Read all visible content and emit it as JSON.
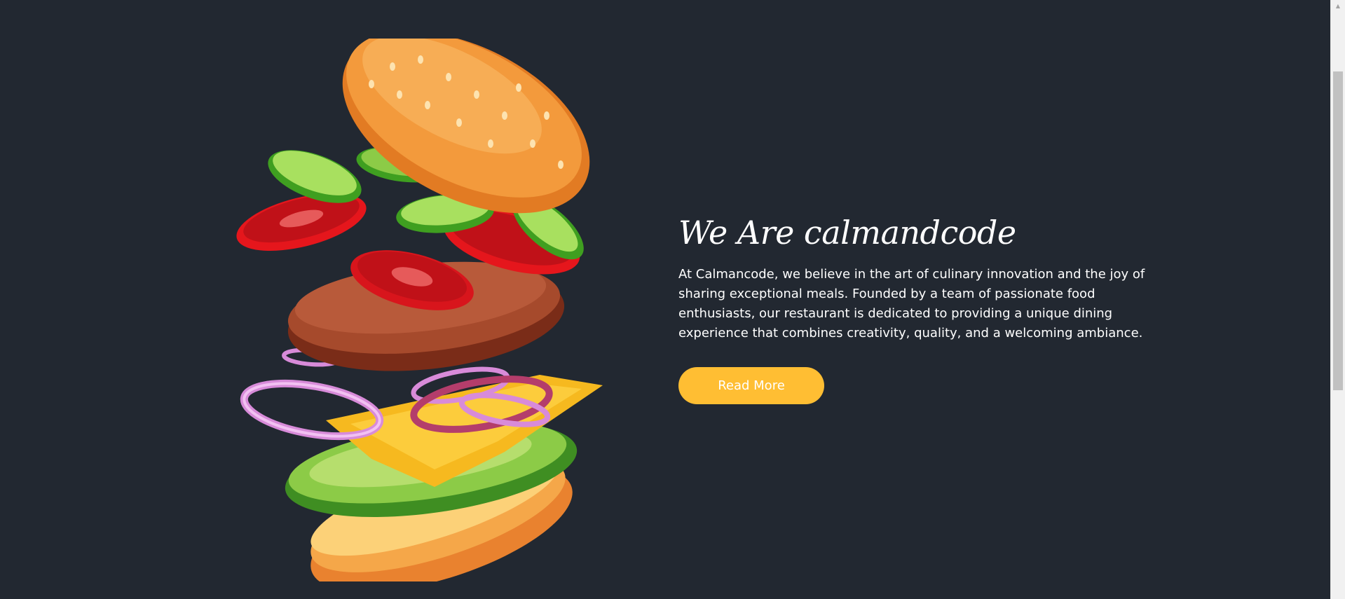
{
  "about": {
    "title": "We Are calmandcode",
    "text": "At Calmancode, we believe in the art of culinary innovation and the joy of sharing exceptional meals. Founded by a team of passionate food enthusiasts, our restaurant is dedicated to providing a unique dining experience that combines creativity, quality, and a welcoming ambiance.",
    "read_more_label": "Read More"
  },
  "theme": {
    "background": "#222831",
    "accent": "#ffbe33",
    "text": "#ffffff"
  },
  "icons": {
    "burger": "burger-illustration",
    "scroll_up": "chevron-up-icon"
  }
}
